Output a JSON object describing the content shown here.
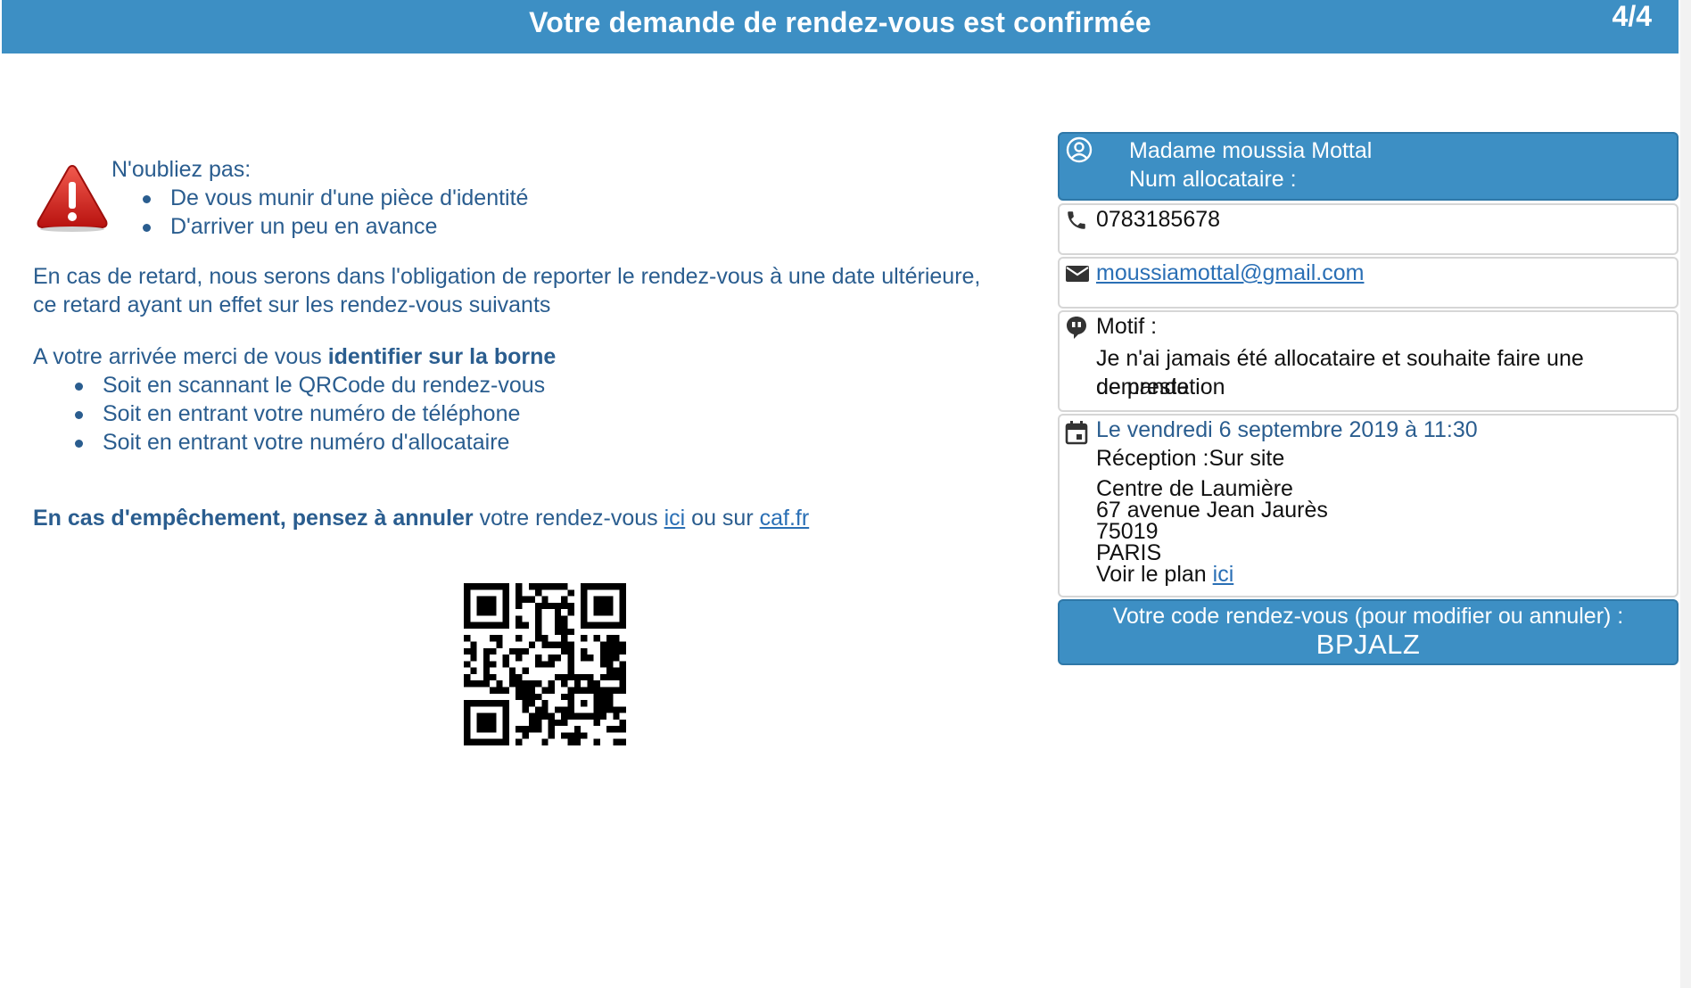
{
  "header": {
    "title": "Votre demande de rendez-vous est confirmée",
    "step": "4/4"
  },
  "reminder": {
    "title": "N'oubliez pas:",
    "items": [
      "De vous munir d'une pièce d'identité",
      "D'arriver un peu en avance"
    ]
  },
  "delay": {
    "line1": "En cas de retard, nous serons dans l'obligation de reporter le rendez-vous à une date ultérieure,",
    "line2": "ce retard ayant un effet sur les rendez-vous suivants"
  },
  "arrival": {
    "intro_start": "A votre arrivée merci de vous ",
    "intro_strong": "identifier sur la borne",
    "items": [
      "Soit en scannant le QRCode du rendez-vous",
      "Soit en entrant votre numéro de téléphone",
      "Soit en entrant votre numéro d'allocataire"
    ]
  },
  "cancel": {
    "strong": "En cas d'empêchement, pensez à annuler",
    "middle": " votre rendez-vous ",
    "link1": "ici",
    "between": " ou sur ",
    "link2": "caf.fr"
  },
  "profile": {
    "name": "Madame moussia Mottal",
    "num_label": "Num allocataire :"
  },
  "contact": {
    "phone": "0783185678",
    "email": "moussiamottal@gmail.com"
  },
  "motif": {
    "label": "Motif :",
    "line1": "Je n'ai jamais été allocataire et souhaite faire une demande",
    "line2": "de prestation"
  },
  "appointment": {
    "date": "Le vendredi 6 septembre 2019 à 11:30",
    "reception": "Réception :Sur site",
    "center": "Centre de Laumière",
    "street": "67 avenue Jean Jaurès",
    "zip": "75019",
    "city": "PARIS",
    "map_prefix": "Voir le plan ",
    "map_link": "ici"
  },
  "code": {
    "label": "Votre code rendez-vous (pour modifier ou annuler) :",
    "value": "BPJALZ"
  },
  "icons": {
    "warning": "warning-triangle-icon",
    "user": "user-circle-icon",
    "phone": "phone-icon",
    "email": "envelope-icon",
    "motif": "chat-bubble-icon",
    "calendar": "calendar-icon"
  }
}
